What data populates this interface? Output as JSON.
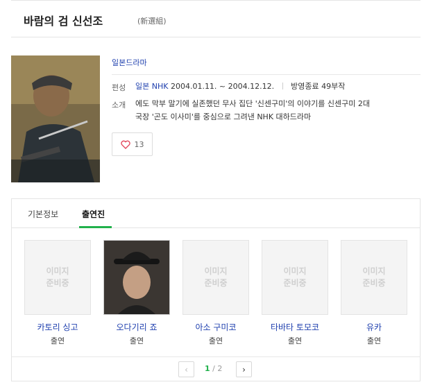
{
  "header": {
    "title": "바람의 검 신선조",
    "title_hanja": "(新選組)"
  },
  "info": {
    "genre": "일본드라마",
    "schedule_label": "편성",
    "broadcaster": "일본 NHK",
    "period": "2004.01.11. ~ 2004.12.12.",
    "status": "방영종료 49부작",
    "synopsis_label": "소개",
    "synopsis_line1": "에도 막부 말기에 실존했던 무사 집단 '신센구미'의 이야기를 신센구미 2대",
    "synopsis_line2": "국장 '곤도 이사미'를 중심으로 그려낸 NHK 대하드라마",
    "like_count": "13",
    "like_icon": "heart-outline-icon"
  },
  "tabs": [
    {
      "label": "기본정보"
    },
    {
      "label": "출연진"
    }
  ],
  "placeholder": {
    "line1": "이미지",
    "line2": "준비중"
  },
  "cast": [
    {
      "name": "카토리 싱고",
      "role": "출연"
    },
    {
      "name": "오다기리 죠",
      "role": "출연"
    },
    {
      "name": "아소 구미코",
      "role": "출연"
    },
    {
      "name": "타바타 토모코",
      "role": "출연"
    },
    {
      "name": "유카",
      "role": "출연"
    }
  ],
  "pagination": {
    "prev": "‹",
    "current": "1",
    "separator": "/",
    "total": "2",
    "next": "›"
  },
  "colors": {
    "link": "#1e3fae",
    "accent": "#21b14b"
  }
}
